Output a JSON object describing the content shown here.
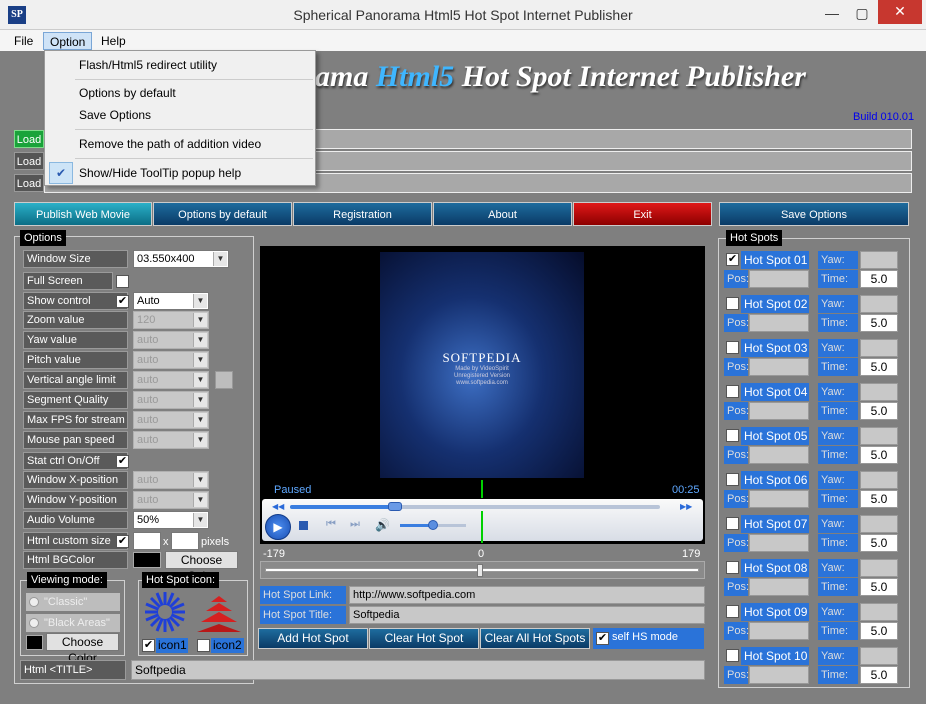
{
  "window": {
    "title": "Spherical Panorama Html5 Hot Spot Internet Publisher",
    "icon": "SP",
    "min": "—",
    "max": "▢",
    "close": "✕"
  },
  "menubar": {
    "items": [
      "File",
      "Option",
      "Help"
    ]
  },
  "dropdown": {
    "items": [
      "Flash/Html5 redirect utility",
      "Options by default",
      "Save Options",
      "Remove the path of addition video",
      "Show/Hide ToolTip popup help"
    ],
    "check": "✔"
  },
  "banner": {
    "title_part1": "Spherical Panorama ",
    "title_part2": "Html5",
    "title_part3": " Hot Spot Internet Publisher",
    "build": "Build 010.01",
    "visible_part1": "ama "
  },
  "load": {
    "label": "Load"
  },
  "toolbar": {
    "publish": "Publish Web Movie",
    "options_default": "Options by default",
    "registration": "Registration",
    "about": "About",
    "exit": "Exit",
    "save_options": "Save Options"
  },
  "options": {
    "title": "Options",
    "rows": [
      {
        "label": "Window Size",
        "value": "03.550x400",
        "disabled": false
      },
      {
        "label": "Full Screen mode"
      },
      {
        "label": "Show control",
        "value": "Auto",
        "disabled": false
      },
      {
        "label": "Zoom value",
        "value": "120",
        "disabled": true
      },
      {
        "label": "Yaw value",
        "value": "auto",
        "disabled": true
      },
      {
        "label": "Pitch value",
        "value": "auto",
        "disabled": true
      },
      {
        "label": "Vertical angle limit",
        "value": "auto",
        "disabled": true
      },
      {
        "label": "Segment Quality",
        "value": "auto",
        "disabled": true
      },
      {
        "label": "Max FPS for stream",
        "value": "auto",
        "disabled": true
      },
      {
        "label": "Mouse pan speed",
        "value": "auto",
        "disabled": true
      },
      {
        "label": "Stat ctrl On/Off"
      },
      {
        "label": "Window X-position",
        "value": "auto",
        "disabled": true
      },
      {
        "label": "Window Y-position",
        "value": "auto",
        "disabled": true
      },
      {
        "label": "Audio Volume",
        "value": "50%",
        "disabled": false
      },
      {
        "label": "Html custom size"
      },
      {
        "label": "Html BGColor"
      }
    ],
    "x_sep": "x",
    "pixels": "pixels",
    "choose_color": "Choose Color"
  },
  "viewing": {
    "title": "Viewing mode:",
    "classic": "\"Classic\"",
    "black": "\"Black Areas\"",
    "choose_color": "Choose Color"
  },
  "hsicon": {
    "title": "Hot Spot icon:",
    "icon1": "icon1",
    "icon2": "icon2"
  },
  "html_title": {
    "label": "Html <TITLE>",
    "value": "Softpedia"
  },
  "player": {
    "status": "Paused",
    "time": "00:25",
    "scale_min": "-179",
    "scale_mid": "0",
    "scale_max": "179",
    "brand": "SOFTPEDIA",
    "brand_sub": "Made by VideoSpirit",
    "brand_sub2": "Unregistered Version",
    "brand_url": "www.softpedia.com"
  },
  "hslink": {
    "link_label": "Hot Spot Link:",
    "link_value": "http://www.softpedia.com",
    "title_label": "Hot Spot Title:",
    "title_value": "Softpedia"
  },
  "hsbuttons": {
    "add": "Add Hot Spot",
    "clear": "Clear Hot Spot",
    "clear_all": "Clear All Hot Spots",
    "self": "self HS mode"
  },
  "hotspots": {
    "title": "Hot Spots",
    "yaw": "Yaw:",
    "pos": "Pos:",
    "time_label": "Time:",
    "items": [
      {
        "name": "Hot Spot 01",
        "time": "5.0",
        "checked": true
      },
      {
        "name": "Hot Spot 02",
        "time": "5.0",
        "checked": false
      },
      {
        "name": "Hot Spot 03",
        "time": "5.0",
        "checked": false
      },
      {
        "name": "Hot Spot 04",
        "time": "5.0",
        "checked": false
      },
      {
        "name": "Hot Spot 05",
        "time": "5.0",
        "checked": false
      },
      {
        "name": "Hot Spot 06",
        "time": "5.0",
        "checked": false
      },
      {
        "name": "Hot Spot 07",
        "time": "5.0",
        "checked": false
      },
      {
        "name": "Hot Spot 08",
        "time": "5.0",
        "checked": false
      },
      {
        "name": "Hot Spot 09",
        "time": "5.0",
        "checked": false
      },
      {
        "name": "Hot Spot 10",
        "time": "5.0",
        "checked": false
      }
    ]
  }
}
